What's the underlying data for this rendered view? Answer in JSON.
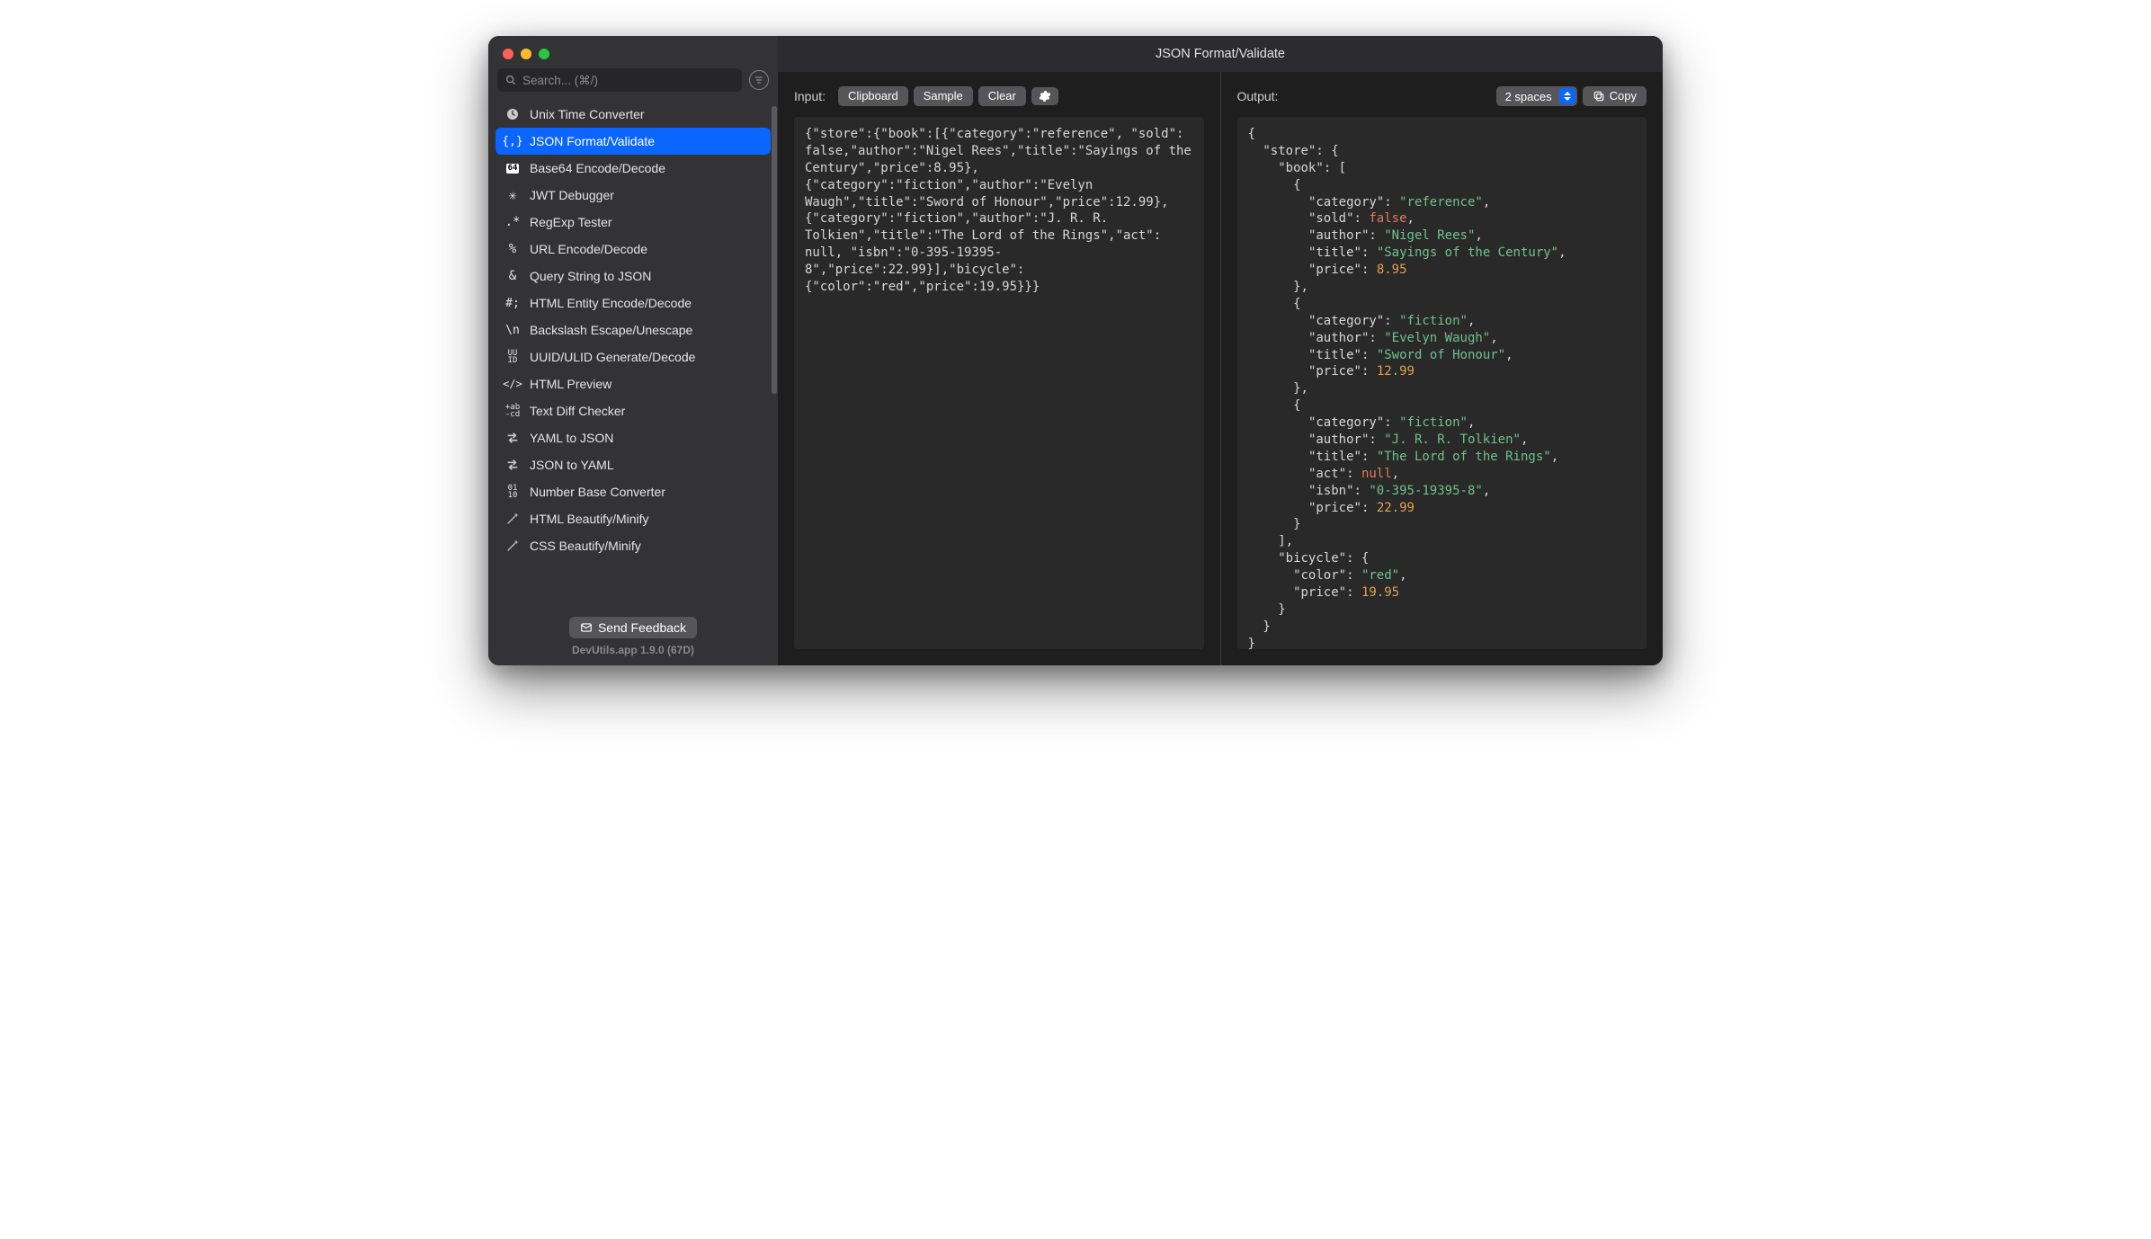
{
  "window_title": "JSON Format/Validate",
  "search": {
    "placeholder": "Search... (⌘/)"
  },
  "sidebar": {
    "items": [
      {
        "icon": "clock-icon",
        "label": "Unix Time Converter"
      },
      {
        "icon": "braces-icon",
        "label": "JSON Format/Validate",
        "active": true
      },
      {
        "icon": "base64-icon",
        "label": "Base64 Encode/Decode"
      },
      {
        "icon": "jwt-icon",
        "label": "JWT Debugger"
      },
      {
        "icon": "regex-icon",
        "label": "RegExp Tester"
      },
      {
        "icon": "percent-icon",
        "label": "URL Encode/Decode"
      },
      {
        "icon": "ampersand-icon",
        "label": "Query String to JSON"
      },
      {
        "icon": "hash-icon",
        "label": "HTML Entity Encode/Decode"
      },
      {
        "icon": "backslash-icon",
        "label": "Backslash Escape/Unescape"
      },
      {
        "icon": "uuid-icon",
        "label": "UUID/ULID Generate/Decode"
      },
      {
        "icon": "code-icon",
        "label": "HTML Preview"
      },
      {
        "icon": "diff-icon",
        "label": "Text Diff Checker"
      },
      {
        "icon": "swap-icon",
        "label": "YAML to JSON"
      },
      {
        "icon": "swap-icon",
        "label": "JSON to YAML"
      },
      {
        "icon": "binary-icon",
        "label": "Number Base Converter"
      },
      {
        "icon": "wand-icon",
        "label": "HTML Beautify/Minify"
      },
      {
        "icon": "wand-icon",
        "label": "CSS Beautify/Minify"
      }
    ],
    "feedback_label": "Send Feedback",
    "version": "DevUtils.app 1.9.0 (67D)"
  },
  "input_pane": {
    "label": "Input:",
    "buttons": {
      "clipboard": "Clipboard",
      "sample": "Sample",
      "clear": "Clear"
    },
    "content": "{\"store\":{\"book\":[{\"category\":\"reference\", \"sold\": false,\"author\":\"Nigel Rees\",\"title\":\"Sayings of the Century\",\"price\":8.95},{\"category\":\"fiction\",\"author\":\"Evelyn Waugh\",\"title\":\"Sword of Honour\",\"price\":12.99},{\"category\":\"fiction\",\"author\":\"J. R. R. Tolkien\",\"title\":\"The Lord of the Rings\",\"act\": null, \"isbn\":\"0-395-19395-8\",\"price\":22.99}],\"bicycle\":{\"color\":\"red\",\"price\":19.95}}}"
  },
  "output_pane": {
    "label": "Output:",
    "indent_label": "2 spaces",
    "copy_label": "Copy",
    "json": {
      "store": {
        "book": [
          {
            "category": "reference",
            "sold": false,
            "author": "Nigel Rees",
            "title": "Sayings of the Century",
            "price": 8.95
          },
          {
            "category": "fiction",
            "author": "Evelyn Waugh",
            "title": "Sword of Honour",
            "price": 12.99
          },
          {
            "category": "fiction",
            "author": "J. R. R. Tolkien",
            "title": "The Lord of the Rings",
            "act": null,
            "isbn": "0-395-19395-8",
            "price": 22.99
          }
        ],
        "bicycle": {
          "color": "red",
          "price": 19.95
        }
      }
    }
  }
}
